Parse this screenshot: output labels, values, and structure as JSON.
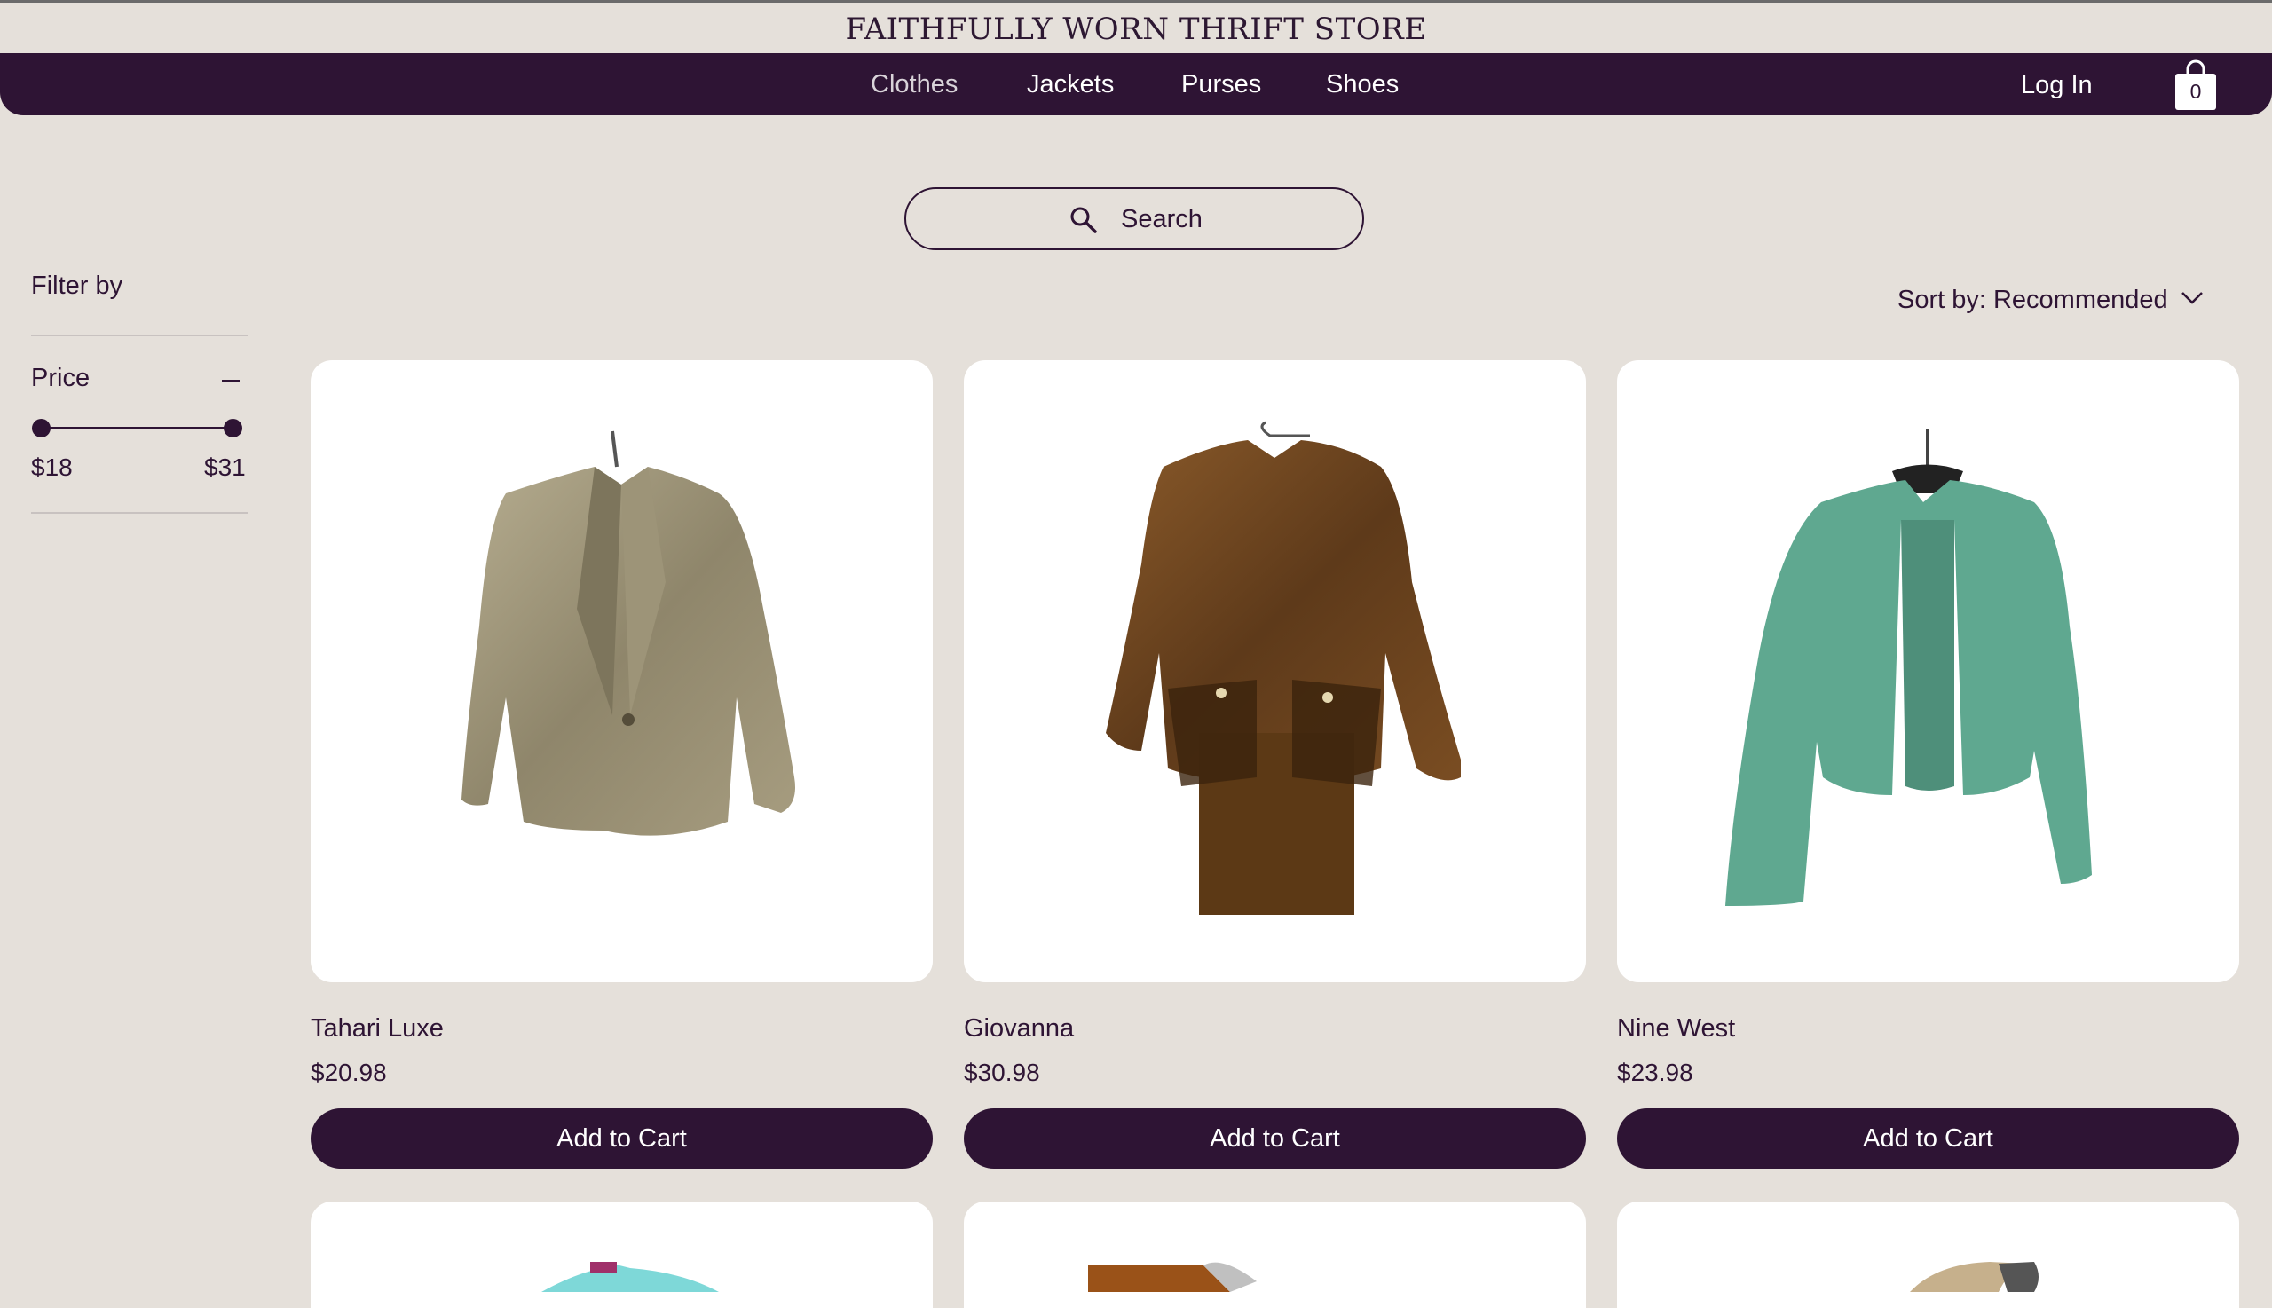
{
  "header": {
    "store_name": "FAITHFULLY WORN THRIFT STORE",
    "nav": [
      "Clothes",
      "Jackets",
      "Purses",
      "Shoes"
    ],
    "login_label": "Log In",
    "cart_count": "0"
  },
  "search": {
    "placeholder": "Search"
  },
  "filters": {
    "title": "Filter by",
    "price_label": "Price",
    "price_min": "$18",
    "price_max": "$31"
  },
  "sort": {
    "label": "Sort by: Recommended"
  },
  "products": [
    {
      "name": "Tahari Luxe",
      "price": "$20.98",
      "button": "Add to Cart",
      "image": "champagne-satin-blazer"
    },
    {
      "name": "Giovanna",
      "price": "$30.98",
      "button": "Add to Cart",
      "image": "brown-skirt-suit"
    },
    {
      "name": "Nine West",
      "price": "$23.98",
      "button": "Add to Cart",
      "image": "teal-open-blazer"
    }
  ],
  "colors": {
    "brand": "#2e1434",
    "background": "#e5e0da"
  }
}
